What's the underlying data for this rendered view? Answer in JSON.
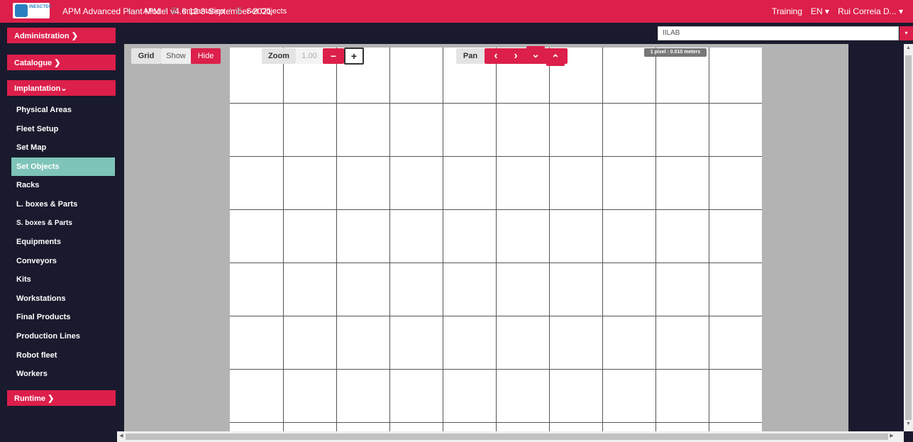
{
  "header": {
    "logo_text": "INESCTEC",
    "app_title": "APM Advanced Plant Model  v4.6.12  3-September-2021",
    "mode": "Training",
    "language": "EN",
    "user": "Rui Correia D..."
  },
  "breadcrumb": {
    "items": [
      "APM",
      "Implantation",
      "Set Objects"
    ]
  },
  "site_select": {
    "value": "IILAB"
  },
  "sidebar": {
    "administration": "Administration",
    "catalogue": "Catalogue",
    "implantation": "Implantation",
    "runtime": "Runtime",
    "items": [
      "Physical Areas",
      "Fleet Setup",
      "Set Map",
      "Set Objects",
      "Racks",
      "L. boxes & Parts",
      "S. boxes & Parts",
      "Equipments",
      "Conveyors",
      "Kits",
      "Workstations",
      "Final Products",
      "Production Lines",
      "Robot fleet",
      "Workers"
    ],
    "active_item": "Set Objects"
  },
  "toolbar": {
    "grid_label": "Grid",
    "show_label": "Show",
    "hide_label": "Hide",
    "zoom_label": "Zoom",
    "zoom_value": "1.00",
    "zoom_out": "−",
    "zoom_in": "+",
    "pan_label": "Pan",
    "pan_left": "‹",
    "pan_right": "›",
    "pan_down": "⌄",
    "pan_up": "⌃"
  },
  "scale_badge": "1 pixel : 0.010 meters",
  "colors": {
    "accent": "#dc1f4b",
    "background": "#1a1a2e",
    "active_item": "#7ec4b8"
  }
}
